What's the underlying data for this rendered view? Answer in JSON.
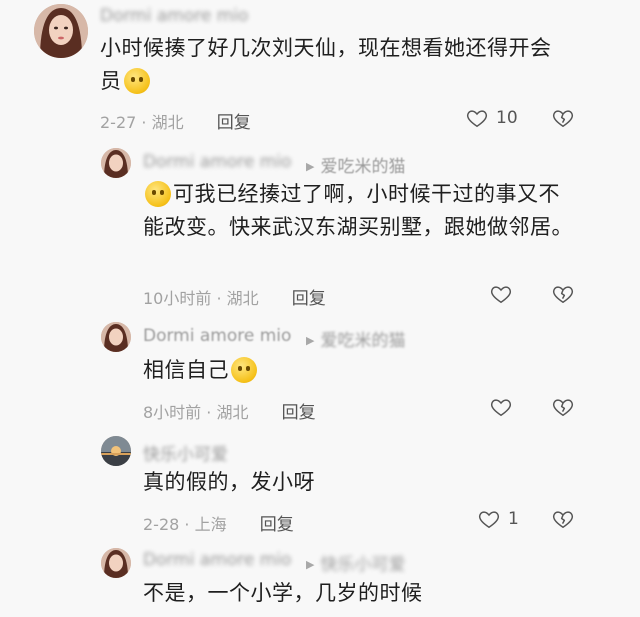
{
  "comments": [
    {
      "name": "Dormi amore mio",
      "text": "小时候揍了好几次刘天仙，现在想看她还得开会员",
      "date": "2-27",
      "location": "湖北",
      "reply_label": "回复",
      "likes": "10"
    },
    {
      "name": "Dormi amore mio",
      "reply_to": "爱吃米的猫",
      "text": "可我已经揍过了啊，小时候干过的事又不能改变。快来武汉东湖买别墅，跟她做邻居。",
      "date": "10小时前",
      "location": "湖北",
      "reply_label": "回复",
      "likes": ""
    },
    {
      "name": "Dormi amore mio",
      "reply_to": "爱吃米的猫",
      "text": "相信自己",
      "date": "8小时前",
      "location": "湖北",
      "reply_label": "回复",
      "likes": ""
    },
    {
      "name": "快乐小可爱",
      "text": "真的假的，发小呀",
      "date": "2-28",
      "location": "上海",
      "reply_label": "回复",
      "likes": "1"
    },
    {
      "name": "Dormi amore mio",
      "reply_to": "快乐小可爱",
      "text": "不是，一个小学，几岁的时候",
      "date": "",
      "location": "",
      "reply_label": "",
      "likes": ""
    }
  ],
  "separator": "·",
  "icons": {
    "like": "heart-outline-icon",
    "dislike": "broken-heart-icon",
    "reply_arrow": "triangle-right-icon",
    "emoji_1": "shy-face-emoji",
    "emoji_2": "thinking-face-emoji"
  },
  "colors": {
    "meta_gray": "#a2a2a2",
    "text": "#1f1f1f",
    "background": "#f8f8f8"
  }
}
